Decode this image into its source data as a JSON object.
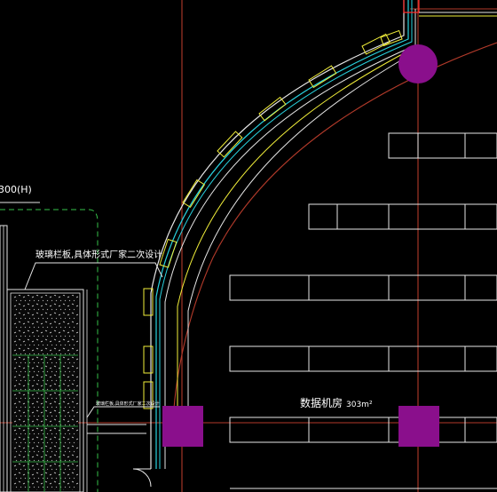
{
  "drawing": {
    "background": "#000000",
    "colors": {
      "grid_red": "#b23a2a",
      "wall_white": "#e6e6e6",
      "yellow": "#f2ef3a",
      "cyan": "#29d3e0",
      "purple": "#8a0f8c",
      "green": "#36c24a",
      "red_accent": "#ff2b2b"
    }
  },
  "labels": {
    "dimension_partial": "300(H)",
    "glass_railing_note": "玻璃栏板,具体形式厂家二次设计",
    "small_railing_note": "玻璃栏板,具体形式厂家二次设计",
    "room_name": "数据机房",
    "room_area": "303m²"
  }
}
